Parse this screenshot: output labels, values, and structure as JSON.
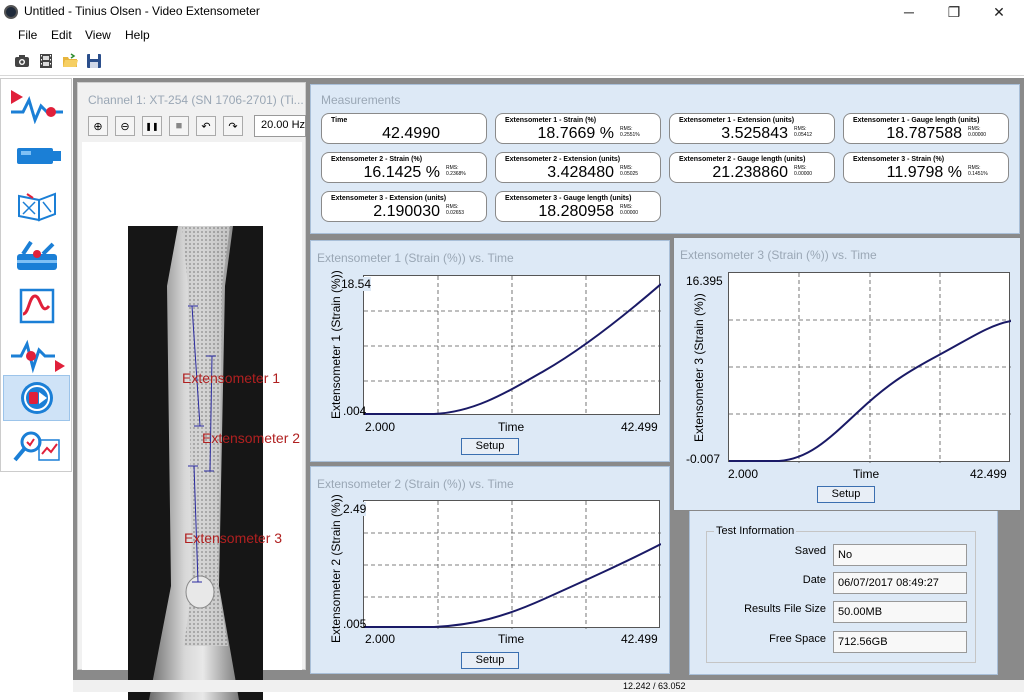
{
  "window": {
    "title": "Untitled - Tinius Olsen - Video Extensometer",
    "minimize_glyph": "─",
    "maximize_glyph": "❐",
    "close_glyph": "✕"
  },
  "menu": {
    "file": "File",
    "edit": "Edit",
    "view": "View",
    "help": "Help"
  },
  "toolbar_icons": [
    "camera-icon",
    "film-icon",
    "open-folder-icon",
    "save-icon"
  ],
  "nav_icons": [
    "run-test-icon",
    "camera-setup-icon",
    "calibration-icon",
    "extensometer-setup-icon",
    "graph-icon",
    "signal-output-icon",
    "video-playback-icon",
    "analysis-icon"
  ],
  "channel": {
    "title": "Channel 1: XT-254 (SN 1706-2701) (Ti...",
    "zoom_value": "20.00 Hz",
    "buttons": {
      "zoom_in": "⊕",
      "zoom_out": "⊖",
      "pause": "❚❚",
      "stop": "■",
      "undo": "↶",
      "redo": "↷"
    },
    "overlays": {
      "ext1": "Extensometer 1",
      "ext2": "Extensometer 2",
      "ext3": "Extensometer 3"
    }
  },
  "measurements": {
    "title": "Measurements",
    "rms_label": "RMS:",
    "items": [
      {
        "label": "Time",
        "value": "42.4990",
        "rms": ""
      },
      {
        "label": "Extensometer 1 - Strain (%)",
        "value": "18.7669 %",
        "rms": "0.2551%"
      },
      {
        "label": "Extensometer 1 - Extension (units)",
        "value": "3.525843",
        "rms": "0.05412"
      },
      {
        "label": "Extensometer 1 - Gauge length (units)",
        "value": "18.787588",
        "rms": "0.00000"
      },
      {
        "label": "Extensometer 2 - Strain (%)",
        "value": "16.1425 %",
        "rms": "0.2368%"
      },
      {
        "label": "Extensometer 2 - Extension (units)",
        "value": "3.428480",
        "rms": "0.05025"
      },
      {
        "label": "Extensometer 2 - Gauge length (units)",
        "value": "21.238860",
        "rms": "0.00000"
      },
      {
        "label": "Extensometer 3 - Strain (%)",
        "value": "11.9798 %",
        "rms": "0.1451%"
      },
      {
        "label": "Extensometer 3 - Extension (units)",
        "value": "2.190030",
        "rms": "0.02653"
      },
      {
        "label": "Extensometer 3 - Gauge length (units)",
        "value": "18.280958",
        "rms": "0.00000"
      }
    ]
  },
  "graphs": {
    "g1": {
      "title": "Extensometer 1 (Strain (%)) vs. Time",
      "xlabel": "Time",
      "ylabel": "Extensometer 1 (Strain (%))",
      "xmin": "2.000",
      "xmax": "42.499",
      "ymin": ".004",
      "ymax": "18.54",
      "setup": "Setup"
    },
    "g2": {
      "title": "Extensometer 2 (Strain (%)) vs. Time",
      "xlabel": "Time",
      "ylabel": "Extensometer 2 (Strain (%))",
      "xmin": "2.000",
      "xmax": "42.499",
      "ymin": ".005",
      "ymax": "2.49",
      "setup": "Setup"
    },
    "g3": {
      "title": "Extensometer 3 (Strain (%)) vs. Time",
      "xlabel": "Time",
      "ylabel": "Extensometer 3 (Strain (%))",
      "xmin": "2.000",
      "xmax": "42.499",
      "ymin": "-0.007",
      "ymax": "16.395",
      "setup": "Setup"
    }
  },
  "test_info": {
    "title": "Test Information",
    "saved_label": "Saved",
    "saved_value": "No",
    "date_label": "Date",
    "date_value": "06/07/2017 08:49:27",
    "size_label": "Results File Size",
    "size_value": "50.00MB",
    "space_label": "Free Space",
    "space_value": "712.56GB"
  },
  "status": {
    "coords": "12.242 / 63.052"
  },
  "colors": {
    "panel_bg": "#dde9f6",
    "curve": "#1a1a66",
    "active_nav": "#cfe3f7",
    "accent_red": "#e0203a",
    "accent_blue": "#1b7fd6"
  }
}
